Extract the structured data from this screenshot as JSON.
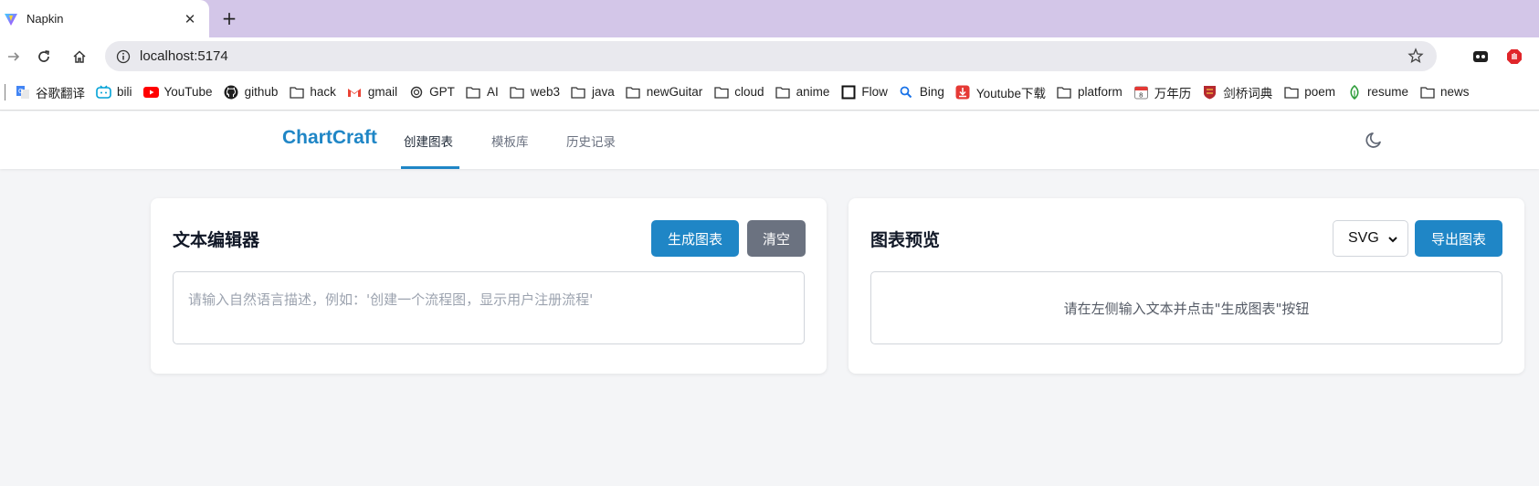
{
  "browser": {
    "tab_title": "Napkin",
    "url": "localhost:5174",
    "bookmarks": [
      {
        "label": "谷歌翻译",
        "icon": "google-translate-icon"
      },
      {
        "label": "bili",
        "icon": "bilibili-icon"
      },
      {
        "label": "YouTube",
        "icon": "youtube-icon"
      },
      {
        "label": "github",
        "icon": "github-icon"
      },
      {
        "label": "hack",
        "icon": "folder-icon"
      },
      {
        "label": "gmail",
        "icon": "gmail-icon"
      },
      {
        "label": "GPT",
        "icon": "openai-icon"
      },
      {
        "label": "AI",
        "icon": "folder-icon"
      },
      {
        "label": "web3",
        "icon": "folder-icon"
      },
      {
        "label": "java",
        "icon": "folder-icon"
      },
      {
        "label": "newGuitar",
        "icon": "folder-icon"
      },
      {
        "label": "cloud",
        "icon": "folder-icon"
      },
      {
        "label": "anime",
        "icon": "folder-icon"
      },
      {
        "label": "Flow",
        "icon": "square-icon"
      },
      {
        "label": "Bing",
        "icon": "search-icon"
      },
      {
        "label": "Youtube下载",
        "icon": "download-icon"
      },
      {
        "label": "platform",
        "icon": "folder-icon"
      },
      {
        "label": "万年历",
        "icon": "calendar-icon"
      },
      {
        "label": "剑桥词典",
        "icon": "cambridge-icon"
      },
      {
        "label": "poem",
        "icon": "folder-icon"
      },
      {
        "label": "resume",
        "icon": "leaf-icon"
      },
      {
        "label": "news",
        "icon": "folder-icon"
      }
    ]
  },
  "app": {
    "brand": "ChartCraft",
    "nav": [
      "创建图表",
      "模板库",
      "历史记录"
    ],
    "active_nav": 0
  },
  "editor": {
    "title": "文本编辑器",
    "generate_label": "生成图表",
    "clear_label": "清空",
    "placeholder": "请输入自然语言描述，例如：'创建一个流程图，显示用户注册流程'"
  },
  "preview": {
    "title": "图表预览",
    "format_value": "SVG",
    "export_label": "导出图表",
    "empty_message": "请在左侧输入文本并点击\"生成图表\"按钮"
  },
  "colors": {
    "accent": "#1f86c6",
    "clear_button": "#6b7280",
    "tab_strip": "#d3c6e8"
  }
}
